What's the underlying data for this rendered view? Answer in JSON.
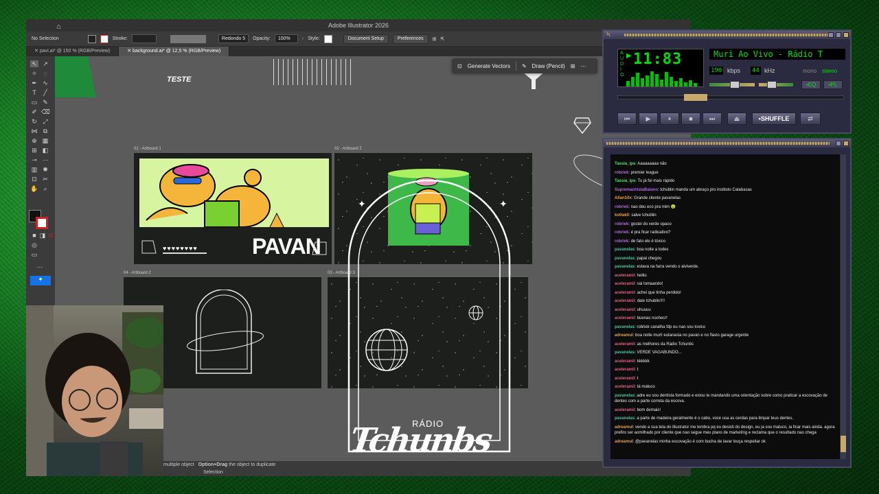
{
  "illustrator": {
    "title": "Adobe Illustrator 2026",
    "control_bar": {
      "selection": "No Selection",
      "stroke_label": "Stroke:",
      "brush_value": "Redondo 5",
      "opacity_label": "Opacity:",
      "opacity_value": "100%",
      "style_label": "Style:",
      "document_setup": "Document Setup",
      "preferences": "Preferences"
    },
    "tabs": [
      {
        "label": "pavi.ai* @ 150 % (RGB/Preview)"
      },
      {
        "label": "background.ai* @ 12,5 % (RGB/Preview)"
      }
    ],
    "floating_bar": {
      "generate": "Generate Vectors",
      "draw": "Draw (Pencil)"
    },
    "artboards": [
      {
        "label": "01 - Artboard 1"
      },
      {
        "label": "02 - Artboard 2"
      },
      {
        "label": "04 - Artboard 2"
      },
      {
        "label": "03 - Artboard 3"
      }
    ],
    "canvas_text": {
      "teste": "TESTE",
      "pavan": "PAVAN",
      "radio": "RÁDIO",
      "logo": "Tchunbs"
    },
    "status": {
      "left": "multiple object",
      "option": "Option+Drag",
      "rest": "the object to duplicate",
      "selection": "Selection"
    }
  },
  "winamp": {
    "time": "11:83",
    "marquee": "Muri Ao Vivo - Rádio T",
    "kbps_value": "190",
    "kbps_label": "kbps",
    "khz_value": "44",
    "khz_label": "kHz",
    "mono": "mono",
    "stereo": "stereo",
    "eq": "EQ",
    "pl": "PL",
    "shuffle": "SHUFFLE",
    "vis_letters": "AUDIO",
    "colors": {
      "display": "#00e000",
      "accent": "#c8a96a"
    }
  },
  "chat": [
    {
      "user": "Tassia_ips",
      "color": "#5ee07a",
      "text": "Aaaaaaaaa não"
    },
    {
      "user": "robriek",
      "color": "#b06ae0",
      "text": "premier league"
    },
    {
      "user": "Tassia_ips",
      "color": "#5ee07a",
      "text": "Tu já foi mais rápido"
    },
    {
      "user": "SupremachistaBaiano",
      "color": "#b06ae0",
      "text": "tchublin manda um abraço pro instituto Calabasas"
    },
    {
      "user": "Allan10x",
      "color": "#f0a040",
      "text": "Grande cliente pavanelas"
    },
    {
      "user": "robriek",
      "color": "#b06ae0",
      "text": "nao deu eco pra mim 🤢"
    },
    {
      "user": "kottak0",
      "color": "#f0a040",
      "text": "salve tchublin"
    },
    {
      "user": "robriek",
      "color": "#b06ae0",
      "text": "gostei do verde opaco"
    },
    {
      "user": "robriek",
      "color": "#b06ae0",
      "text": "é pra ficar radioativo?"
    },
    {
      "user": "robriek",
      "color": "#b06ae0",
      "text": "de fato ele é tóxico"
    },
    {
      "user": "pavanelas",
      "color": "#3ec8a0",
      "text": "boa noite a todes"
    },
    {
      "user": "pavanelas",
      "color": "#3ec8a0",
      "text": "papai chegou"
    },
    {
      "user": "pavanelas",
      "color": "#3ec8a0",
      "text": "estava na farra vendo o alviverde."
    },
    {
      "user": "aceleramil",
      "color": "#e06080",
      "text": "hellio"
    },
    {
      "user": "aceleramil",
      "color": "#e06080",
      "text": "vai tomaando!"
    },
    {
      "user": "aceleramil",
      "color": "#e06080",
      "text": "achei que tinha perdido!"
    },
    {
      "user": "aceleramil",
      "color": "#e06080",
      "text": "dale tchublin!!!!"
    },
    {
      "user": "aceleramil",
      "color": "#e06080",
      "text": "uhuuuu"
    },
    {
      "user": "aceleramil",
      "color": "#e06080",
      "text": "buenas noches!!"
    },
    {
      "user": "pavanelas",
      "color": "#3ec8a0",
      "text": "robriek canalha fdp eu nao sou toxico"
    },
    {
      "user": "adreamul",
      "color": "#f0a040",
      "text": "boa noite muri! eutanasia no pavan e no flavio garage urgente"
    },
    {
      "user": "aceleramil",
      "color": "#e06080",
      "text": "as melhores da Rádio Tchunbs"
    },
    {
      "user": "pavanelas",
      "color": "#3ec8a0",
      "text": "VERDE VAGABUNDO..."
    },
    {
      "user": "aceleramil",
      "color": "#e06080",
      "text": "kkkkkk"
    },
    {
      "user": "aceleramil",
      "color": "#e06080",
      "text": "t"
    },
    {
      "user": "aceleramil",
      "color": "#e06080",
      "text": "t"
    },
    {
      "user": "aceleramil",
      "color": "#e06080",
      "text": "tá maluco"
    },
    {
      "user": "pavanelas",
      "color": "#3ec8a0",
      "text": "adre eu sou dentista formado e estou te mandando uma orientação sobre como praticar a escovação de dentes com a parte correta da escova.",
      "wrap": true
    },
    {
      "user": "aceleramil",
      "color": "#e06080",
      "text": "bom demais!"
    },
    {
      "user": "pavanelas",
      "color": "#3ec8a0",
      "text": "a parte de madeira geralmente é o cabo, voce usa as cerdas para limpar teus dentes."
    },
    {
      "user": "adreamul",
      "color": "#f0a040",
      "text": "vendo a sua tela do illustrator me lembra pq eu desisti do design, eu ja sou maluco, ia ficar mais ainda. agora prefiro ser aomilhado por cliente que nao segue meu plano de marketing e reclama que o resultado nao chega",
      "wrap": true
    },
    {
      "user": "adreamul",
      "color": "#f0a040",
      "text": "@pavanelas minha escovação é com bucha de lavar louça respeitar ok"
    }
  ]
}
